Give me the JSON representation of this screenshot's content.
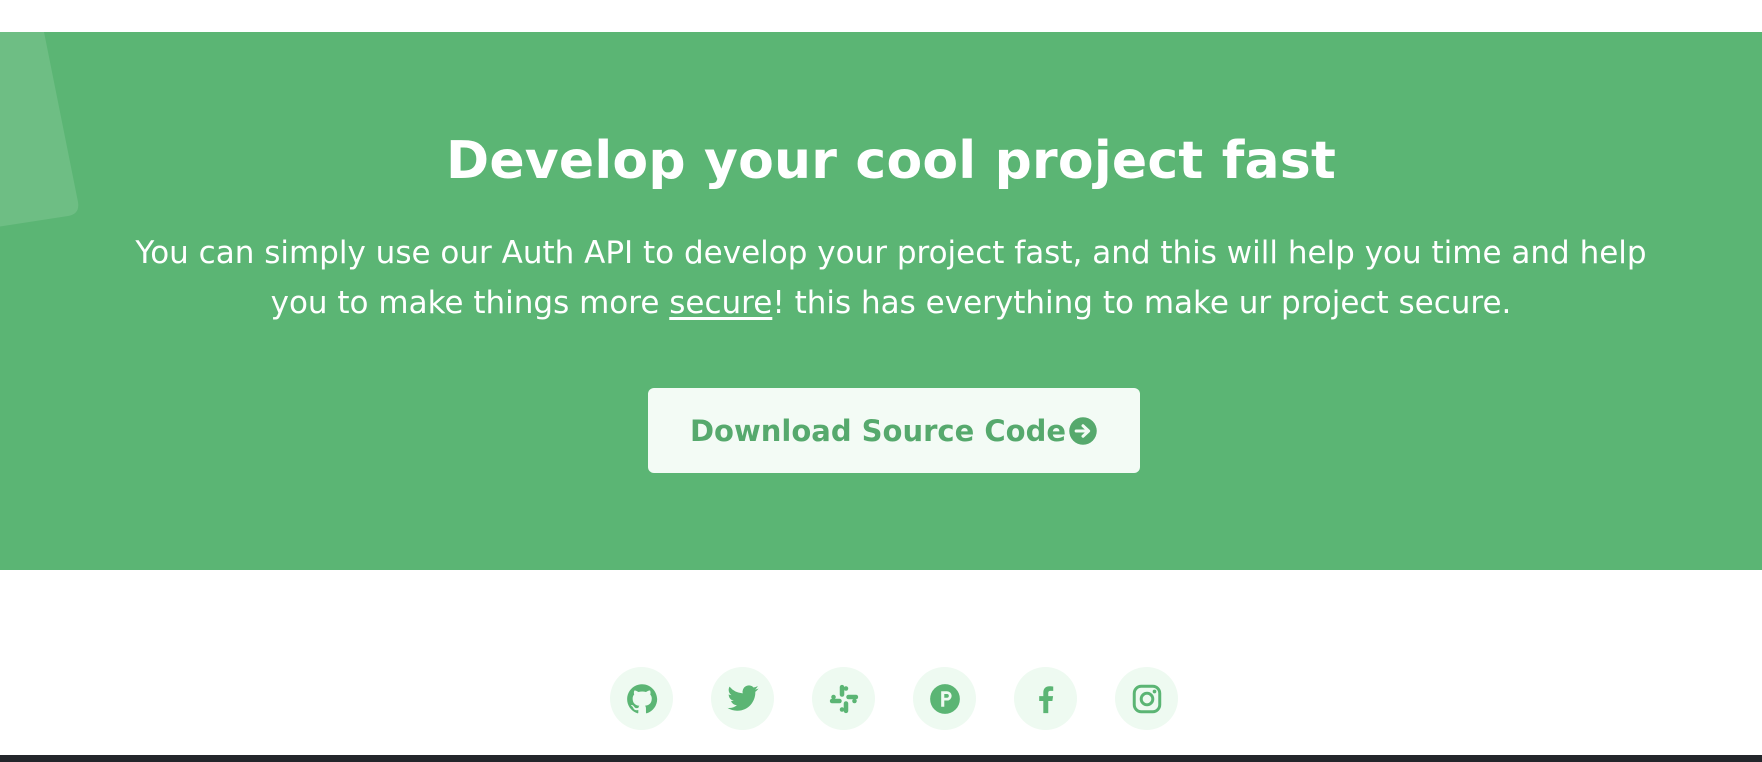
{
  "hero": {
    "title": "Develop your cool project fast",
    "description_before": "You can simply use our Auth API to develop your project fast, and this will help you time and help you to make things more ",
    "description_link": "secure",
    "description_after": "! this has everything to make ur project secure.",
    "button_label": "Download Source Code",
    "button_icon": "arrow-circle-right-icon"
  },
  "socials": [
    {
      "name": "github",
      "icon": "github-icon"
    },
    {
      "name": "twitter",
      "icon": "twitter-icon"
    },
    {
      "name": "slack",
      "icon": "slack-icon"
    },
    {
      "name": "producthunt",
      "icon": "producthunt-icon"
    },
    {
      "name": "facebook",
      "icon": "facebook-icon"
    },
    {
      "name": "instagram",
      "icon": "instagram-icon"
    }
  ],
  "colors": {
    "hero_background": "#5bb574",
    "accent": "#56a96d",
    "button_background": "#f3fbf5",
    "social_background": "#eefaf1",
    "bottom_bar": "#23262b"
  }
}
